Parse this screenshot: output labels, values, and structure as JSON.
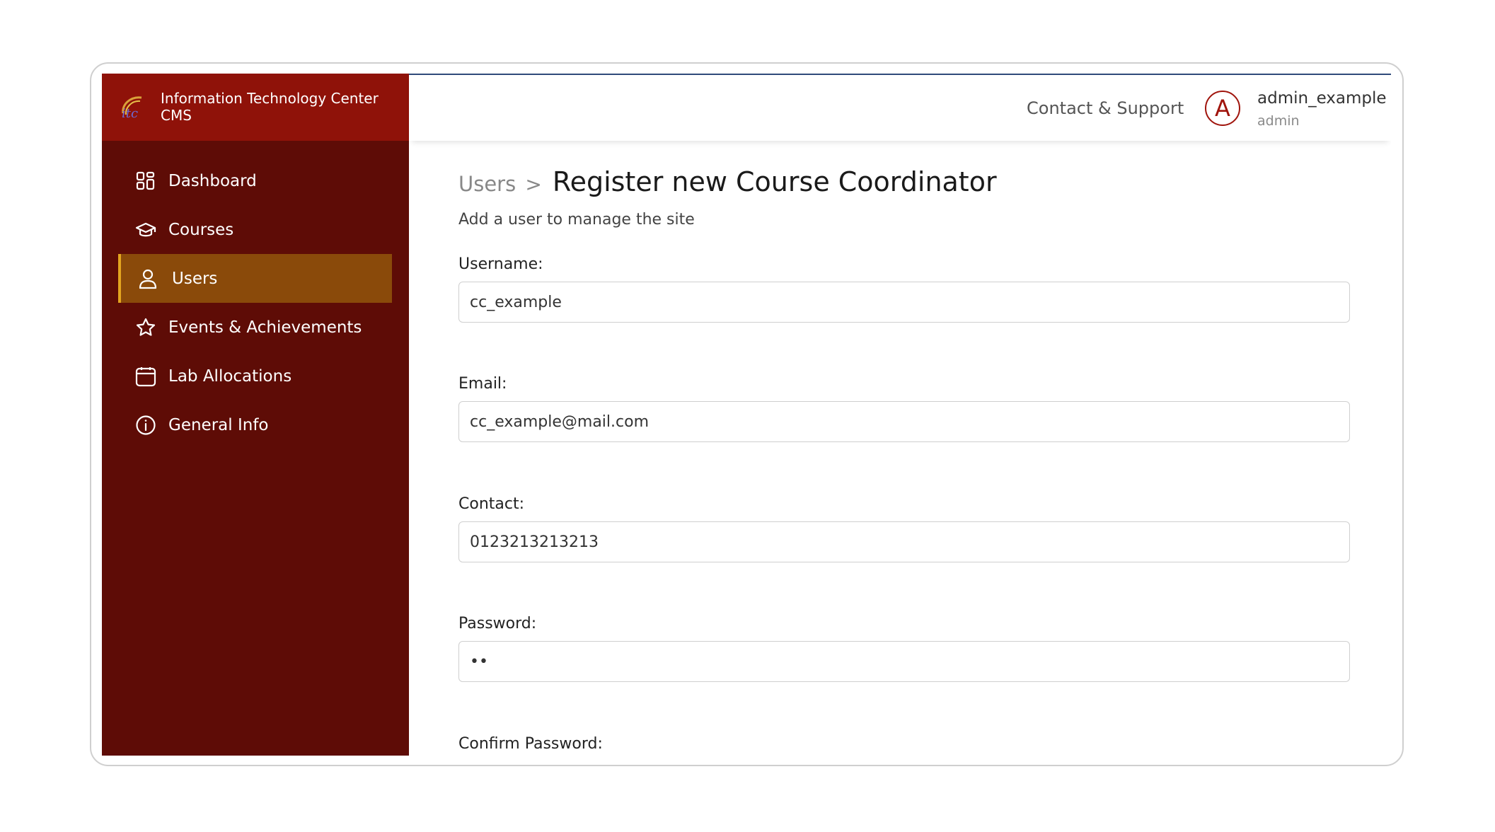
{
  "brand": {
    "title": "Information Technology Center CMS",
    "logo_icon": "itc-logo-icon"
  },
  "sidebar": {
    "items": [
      {
        "label": "Dashboard",
        "icon": "dashboard-grid-icon",
        "active": false
      },
      {
        "label": "Courses",
        "icon": "graduation-cap-icon",
        "active": false
      },
      {
        "label": "Users",
        "icon": "user-icon",
        "active": true
      },
      {
        "label": "Events & Achievements",
        "icon": "star-icon",
        "active": false
      },
      {
        "label": "Lab Allocations",
        "icon": "calendar-icon",
        "active": false
      },
      {
        "label": "General Info",
        "icon": "info-icon",
        "active": false
      }
    ]
  },
  "header": {
    "contact_link": "Contact & Support",
    "avatar_letter": "A",
    "user_name": "admin_example",
    "user_role": "admin"
  },
  "main": {
    "breadcrumb_parent": "Users",
    "breadcrumb_separator": ">",
    "page_title": "Register new Course Coordinator",
    "subtitle": "Add a user to manage the site",
    "fields": [
      {
        "label": "Username:",
        "value": "cc_example"
      },
      {
        "label": "Email:",
        "value": "cc_example@mail.com"
      },
      {
        "label": "Contact:",
        "value": "0123213213213"
      },
      {
        "label": "Password:",
        "value": "••"
      },
      {
        "label": "Confirm Password:",
        "value": ""
      }
    ]
  },
  "colors": {
    "sidebar_bg": "#5e0c06",
    "brand_bg": "#8f1209",
    "active_item_bg": "#8a4a0a",
    "active_item_border": "#e3a51f",
    "avatar_accent": "#a0140c"
  }
}
